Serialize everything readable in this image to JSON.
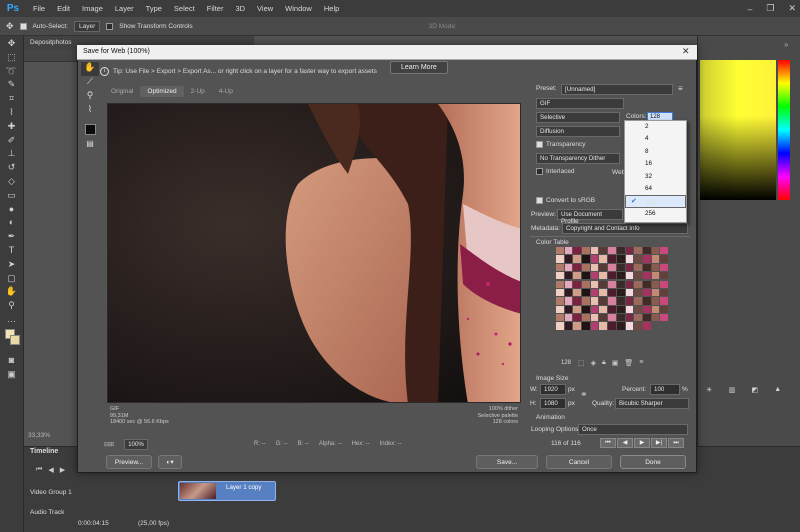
{
  "menubar": {
    "logo": "Ps",
    "items": [
      "File",
      "Edit",
      "Image",
      "Layer",
      "Type",
      "Select",
      "Filter",
      "3D",
      "View",
      "Window",
      "Help"
    ]
  },
  "options": {
    "auto_select_label": "Auto-Select:",
    "auto_select_value": "Layer",
    "show_transform_label": "Show Transform Controls",
    "mode_3d_label": "3D Mode:"
  },
  "document": {
    "tab": "Depositphotos",
    "zoom_readout": "33,33%"
  },
  "dialog": {
    "title": "Save for Web (100%)",
    "tip": "Tip: Use File > Export > Export As...   or right click on a layer for a faster way to export assets",
    "learn_more": "Learn More",
    "tabs": [
      "Original",
      "Optimized",
      "2-Up",
      "4-Up"
    ],
    "active_tab": "Optimized",
    "info_left": [
      "GIF",
      "99,31M",
      "18400 sec @ 56.6 Kbps"
    ],
    "info_right": [
      "100% dither",
      "Selective palette",
      "128 colors"
    ],
    "status": {
      "zoom": "100%",
      "r": "R: --",
      "g": "G: --",
      "b": "B: --",
      "alpha": "Alpha: --",
      "hex": "Hex: --",
      "index": "Index: --"
    },
    "buttons": {
      "preview": "Preview...",
      "save": "Save...",
      "cancel": "Cancel",
      "done": "Done"
    },
    "settings": {
      "preset_label": "Preset:",
      "preset_value": "[Unnamed]",
      "format": "GIF",
      "reduction": "Selective",
      "dither_algo": "Diffusion",
      "colors_label": "Colors:",
      "colors_value": "128",
      "transparency_label": "Transparency",
      "transparency_dither": "No Transparency Dither",
      "interlaced_label": "Interlaced",
      "web_snap_label": "Web",
      "convert_srgb_label": "Convert to sRGB",
      "preview_label": "Preview:",
      "preview_value": "Use Document Profile",
      "metadata_label": "Metadata:",
      "metadata_value": "Copyright and Contact Info",
      "color_table_label": "Color Table",
      "color_count": "128",
      "image_size_label": "Image Size",
      "w_label": "W:",
      "w_value": "1920",
      "h_label": "H:",
      "h_value": "1080",
      "unit": "px",
      "percent_label": "Percent:",
      "percent_value": "100",
      "percent_unit": "%",
      "quality_label": "Quality:",
      "quality_value": "Bicubic Sharper",
      "animation_label": "Animation",
      "looping_label": "Looping Options:",
      "looping_value": "Once",
      "frame_counter": "116 of 116"
    },
    "colors_menu": {
      "options": [
        "2",
        "4",
        "8",
        "16",
        "32",
        "64",
        "128",
        "256"
      ],
      "selected": "128"
    }
  },
  "timeline": {
    "title": "Timeline",
    "video_group": "Video Group 1",
    "audio_track": "Audio Track",
    "clip_label": "Layer 1 copy",
    "timecode": "0:00:04:15",
    "fps": "(25,00 fps)"
  },
  "colors": {
    "accent": "#31a8ff",
    "clip": "#5680c2",
    "menu_selected": "#dbe9fb"
  }
}
